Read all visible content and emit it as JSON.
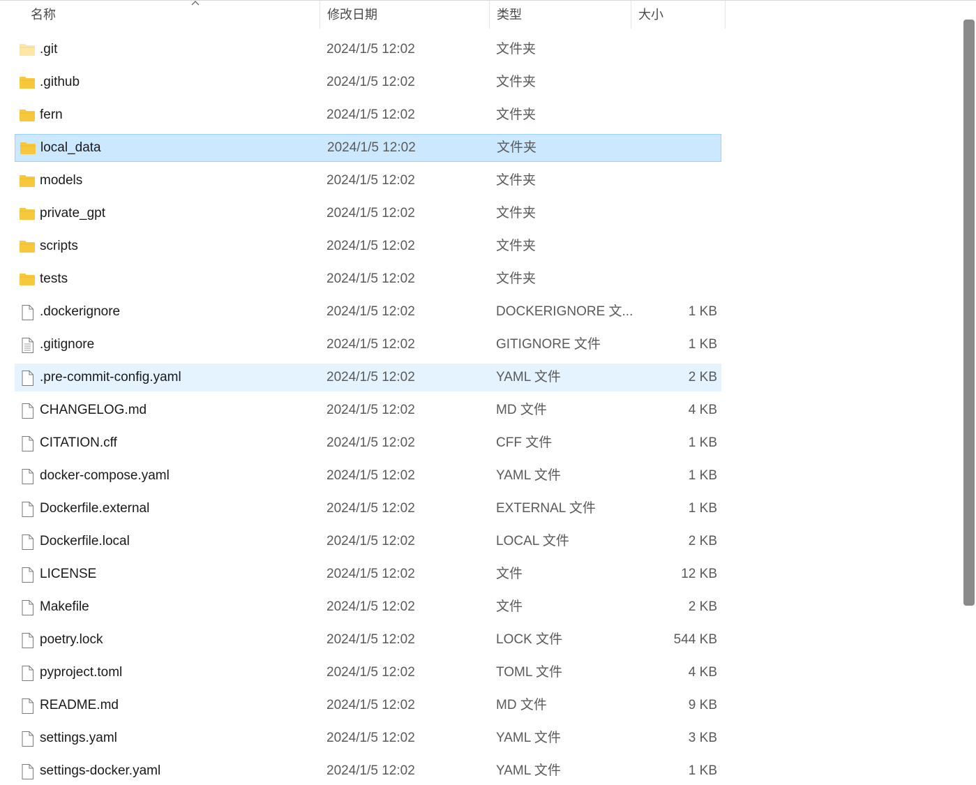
{
  "header": {
    "name_label": "名称",
    "date_label": "修改日期",
    "type_label": "类型",
    "size_label": "大小",
    "sort_indicator": "^"
  },
  "files": [
    {
      "name": ".git",
      "date": "2024/1/5 12:02",
      "type": "文件夹",
      "size": "",
      "icon": "folder-light-icon",
      "state": ""
    },
    {
      "name": ".github",
      "date": "2024/1/5 12:02",
      "type": "文件夹",
      "size": "",
      "icon": "folder-icon",
      "state": ""
    },
    {
      "name": "fern",
      "date": "2024/1/5 12:02",
      "type": "文件夹",
      "size": "",
      "icon": "folder-icon",
      "state": ""
    },
    {
      "name": "local_data",
      "date": "2024/1/5 12:02",
      "type": "文件夹",
      "size": "",
      "icon": "folder-icon",
      "state": "selected"
    },
    {
      "name": "models",
      "date": "2024/1/5 12:02",
      "type": "文件夹",
      "size": "",
      "icon": "folder-icon",
      "state": ""
    },
    {
      "name": "private_gpt",
      "date": "2024/1/5 12:02",
      "type": "文件夹",
      "size": "",
      "icon": "folder-icon",
      "state": ""
    },
    {
      "name": "scripts",
      "date": "2024/1/5 12:02",
      "type": "文件夹",
      "size": "",
      "icon": "folder-icon",
      "state": ""
    },
    {
      "name": "tests",
      "date": "2024/1/5 12:02",
      "type": "文件夹",
      "size": "",
      "icon": "folder-icon",
      "state": ""
    },
    {
      "name": ".dockerignore",
      "date": "2024/1/5 12:02",
      "type": "DOCKERIGNORE 文...",
      "size": "1 KB",
      "icon": "file-icon",
      "state": ""
    },
    {
      "name": ".gitignore",
      "date": "2024/1/5 12:02",
      "type": "GITIGNORE 文件",
      "size": "1 KB",
      "icon": "text-file-icon",
      "state": ""
    },
    {
      "name": ".pre-commit-config.yaml",
      "date": "2024/1/5 12:02",
      "type": "YAML 文件",
      "size": "2 KB",
      "icon": "file-icon",
      "state": "hover"
    },
    {
      "name": "CHANGELOG.md",
      "date": "2024/1/5 12:02",
      "type": "MD 文件",
      "size": "4 KB",
      "icon": "file-icon",
      "state": ""
    },
    {
      "name": "CITATION.cff",
      "date": "2024/1/5 12:02",
      "type": "CFF 文件",
      "size": "1 KB",
      "icon": "file-icon",
      "state": ""
    },
    {
      "name": "docker-compose.yaml",
      "date": "2024/1/5 12:02",
      "type": "YAML 文件",
      "size": "1 KB",
      "icon": "file-icon",
      "state": ""
    },
    {
      "name": "Dockerfile.external",
      "date": "2024/1/5 12:02",
      "type": "EXTERNAL 文件",
      "size": "1 KB",
      "icon": "file-icon",
      "state": ""
    },
    {
      "name": "Dockerfile.local",
      "date": "2024/1/5 12:02",
      "type": "LOCAL 文件",
      "size": "2 KB",
      "icon": "file-icon",
      "state": ""
    },
    {
      "name": "LICENSE",
      "date": "2024/1/5 12:02",
      "type": "文件",
      "size": "12 KB",
      "icon": "file-icon",
      "state": ""
    },
    {
      "name": "Makefile",
      "date": "2024/1/5 12:02",
      "type": "文件",
      "size": "2 KB",
      "icon": "file-icon",
      "state": ""
    },
    {
      "name": "poetry.lock",
      "date": "2024/1/5 12:02",
      "type": "LOCK 文件",
      "size": "544 KB",
      "icon": "file-icon",
      "state": ""
    },
    {
      "name": "pyproject.toml",
      "date": "2024/1/5 12:02",
      "type": "TOML 文件",
      "size": "4 KB",
      "icon": "file-icon",
      "state": ""
    },
    {
      "name": "README.md",
      "date": "2024/1/5 12:02",
      "type": "MD 文件",
      "size": "9 KB",
      "icon": "file-icon",
      "state": ""
    },
    {
      "name": "settings.yaml",
      "date": "2024/1/5 12:02",
      "type": "YAML 文件",
      "size": "3 KB",
      "icon": "file-icon",
      "state": ""
    },
    {
      "name": "settings-docker.yaml",
      "date": "2024/1/5 12:02",
      "type": "YAML 文件",
      "size": "1 KB",
      "icon": "file-icon",
      "state": ""
    }
  ],
  "colors": {
    "folder": "#f8c83c",
    "folder_light": "#fce7a6",
    "selected_bg": "#cce8ff",
    "hover_bg": "#e5f3ff"
  }
}
